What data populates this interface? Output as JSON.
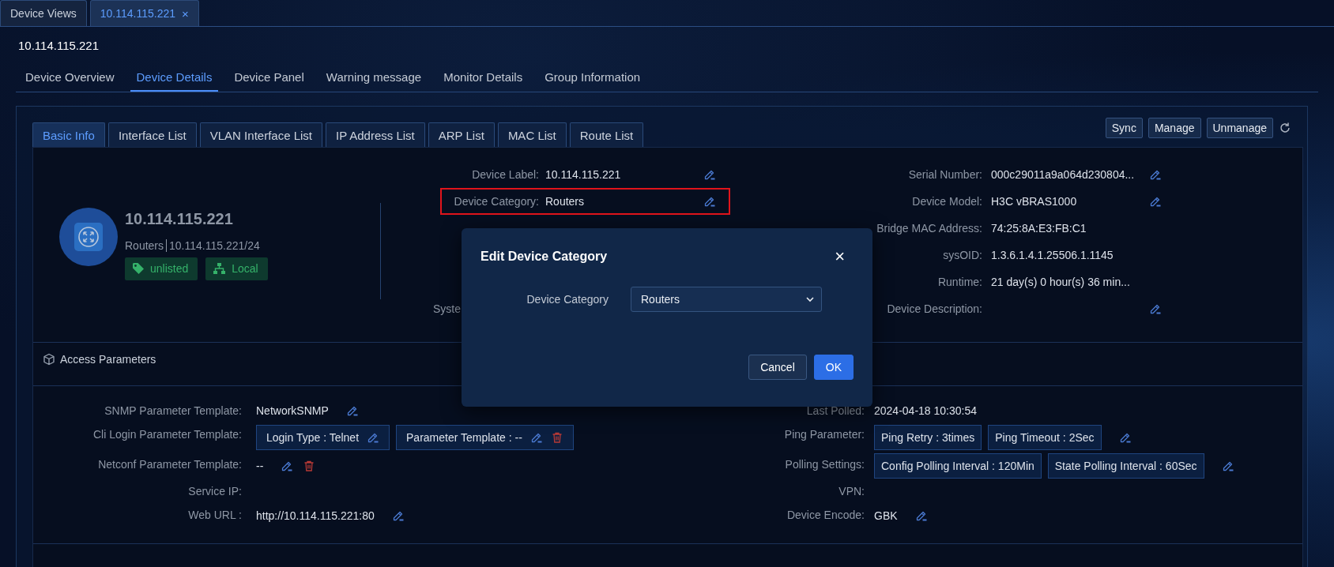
{
  "window_tabs": [
    {
      "label": "Device Views",
      "selected": false,
      "closable": false
    },
    {
      "label": "10.114.115.221",
      "selected": true,
      "closable": true,
      "close_glyph": "×"
    }
  ],
  "page_title": "10.114.115.221",
  "nav_tabs": [
    {
      "label": "Device Overview",
      "selected": false
    },
    {
      "label": "Device Details",
      "selected": true
    },
    {
      "label": "Device Panel",
      "selected": false
    },
    {
      "label": "Warning message",
      "selected": false
    },
    {
      "label": "Monitor Details",
      "selected": false
    },
    {
      "label": "Group Information",
      "selected": false
    }
  ],
  "sub_tabs": [
    {
      "label": "Basic Info",
      "selected": true
    },
    {
      "label": "Interface List",
      "selected": false
    },
    {
      "label": "VLAN Interface List",
      "selected": false
    },
    {
      "label": "IP Address List",
      "selected": false
    },
    {
      "label": "ARP List",
      "selected": false
    },
    {
      "label": "MAC List",
      "selected": false
    },
    {
      "label": "Route List",
      "selected": false
    }
  ],
  "actions": [
    "Sync",
    "Manage",
    "Unmanage"
  ],
  "device": {
    "name": "10.114.115.221",
    "category": "Routers",
    "address": "10.114.115.221/24",
    "badges": [
      {
        "kind": "tag",
        "label": "unlisted"
      },
      {
        "kind": "topology",
        "label": "Local"
      }
    ]
  },
  "basic_fields": [
    {
      "kind": "full",
      "label": "Device Label:",
      "value": "10.114.115.221",
      "editable": true,
      "highlighted": false
    },
    {
      "kind": "full",
      "label": "Device Category:",
      "value": "Routers",
      "editable": true,
      "highlighted": true
    },
    {
      "kind": "cut",
      "label": "Syste"
    }
  ],
  "right_fields": [
    {
      "label": "Serial Number:",
      "value": "000c29011a9a064d230804...",
      "editable": true
    },
    {
      "label": "Device Model:",
      "value": "H3C vBRAS1000",
      "editable": true
    },
    {
      "label": "Bridge MAC Address:",
      "value": "74:25:8A:E3:FB:C1",
      "editable": false
    },
    {
      "label": "sysOID:",
      "value": "1.3.6.1.4.1.25506.1.1145",
      "editable": false
    },
    {
      "label": "Runtime:",
      "value": "21 day(s) 0 hour(s) 36 min...",
      "editable": false
    },
    {
      "label": "Device Description:",
      "editable": true
    }
  ],
  "access_section": {
    "title": "Access Parameters"
  },
  "access_left": [
    {
      "kind": "text",
      "label": "SNMP Parameter Template:",
      "value": "NetworkSNMP",
      "editable": true,
      "deletable": false
    },
    {
      "kind": "chips",
      "label": "Cli Login Parameter Template:",
      "editable": false,
      "deletable": false,
      "chips": [
        {
          "text": "Login Type : Telnet",
          "editable": true,
          "deletable": false
        },
        {
          "text": "Parameter Template : --",
          "editable": true,
          "deletable": true
        }
      ]
    },
    {
      "kind": "text",
      "label": "Netconf Parameter Template:",
      "value": "--",
      "editable": true,
      "deletable": true
    },
    {
      "kind": "text",
      "label": "Service IP:",
      "editable": false,
      "deletable": false
    },
    {
      "kind": "text",
      "label": "Web URL :",
      "value": "http://10.114.115.221:80",
      "editable": true,
      "deletable": false
    }
  ],
  "access_right": [
    {
      "kind": "text",
      "label": "Last Polled:",
      "value": "2024-04-18 10:30:54",
      "editable": false,
      "deletable": false
    },
    {
      "kind": "chips",
      "label": "Ping Parameter:",
      "editable": true,
      "deletable": false,
      "chips": [
        {
          "text": "Ping Retry : 3times",
          "editable": false,
          "deletable": false
        },
        {
          "text": "Ping Timeout : 2Sec",
          "editable": false,
          "deletable": false
        }
      ]
    },
    {
      "kind": "chips",
      "label": "Polling Settings:",
      "editable": true,
      "deletable": false,
      "chips": [
        {
          "text": "Config Polling Interval : 120Min",
          "editable": false,
          "deletable": false
        },
        {
          "text": "State Polling Interval : 60Sec",
          "editable": false,
          "deletable": false
        }
      ]
    },
    {
      "kind": "text",
      "label": "VPN:",
      "editable": false,
      "deletable": false
    },
    {
      "kind": "text",
      "label": "Device Encode:",
      "value": "GBK",
      "editable": true,
      "deletable": false
    }
  ],
  "dialog": {
    "title": "Edit Device Category",
    "close_glyph": "×",
    "field_label": "Device Category",
    "value": "Routers",
    "buttons": [
      {
        "label": "Cancel",
        "kind": "secondary"
      },
      {
        "label": "OK",
        "kind": "primary"
      }
    ]
  }
}
